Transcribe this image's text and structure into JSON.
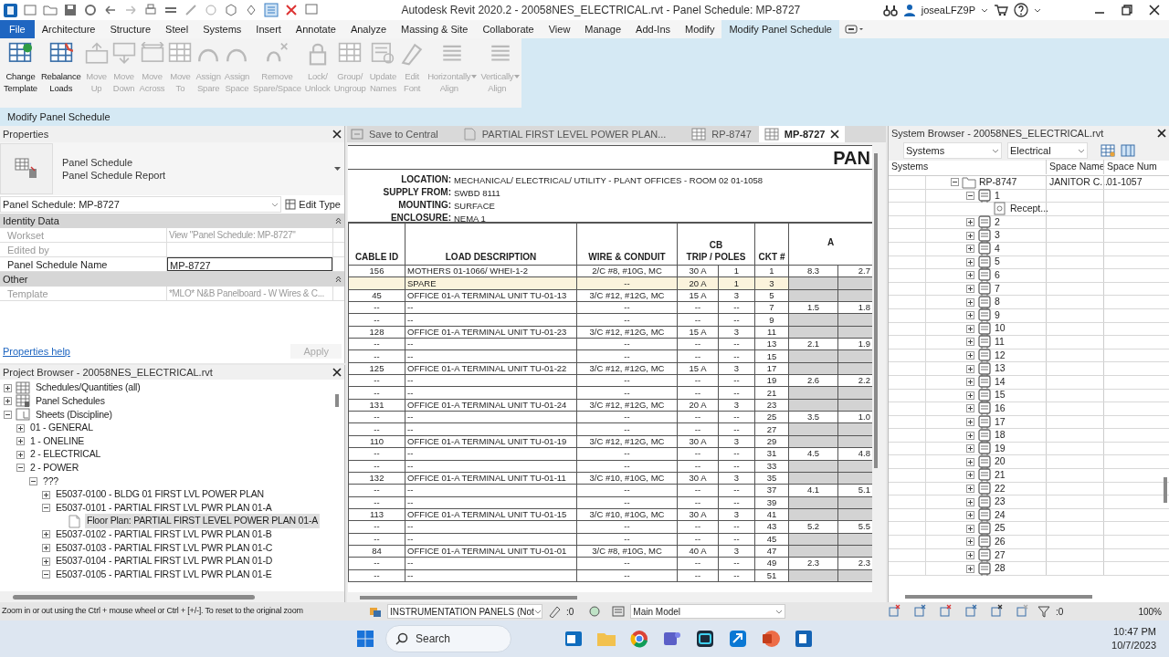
{
  "title_bar": {
    "title": "Autodesk Revit 2020.2 - 20058NES_ELECTRICAL.rvt - Panel Schedule: MP-8727",
    "user": "joseaLFZ9P"
  },
  "ribbon": {
    "file": "File",
    "tabs": [
      {
        "label": "Architecture",
        "selected": false
      },
      {
        "label": "Structure",
        "selected": false
      },
      {
        "label": "Steel",
        "selected": false
      },
      {
        "label": "Systems",
        "selected": false
      },
      {
        "label": "Insert",
        "selected": false
      },
      {
        "label": "Annotate",
        "selected": false
      },
      {
        "label": "Analyze",
        "selected": false
      },
      {
        "label": "Massing & Site",
        "selected": false
      },
      {
        "label": "Collaborate",
        "selected": false
      },
      {
        "label": "View",
        "selected": false
      },
      {
        "label": "Manage",
        "selected": false
      },
      {
        "label": "Add-Ins",
        "selected": false
      },
      {
        "label": "Modify",
        "selected": false
      },
      {
        "label": "Modify Panel Schedule",
        "selected": true
      }
    ],
    "buttons": [
      {
        "label": [
          "Change",
          "Template"
        ],
        "disabled": false
      },
      {
        "label": [
          "Rebalance",
          "Loads"
        ],
        "disabled": false
      },
      {
        "label": [
          "Move",
          "Up"
        ],
        "disabled": true
      },
      {
        "label": [
          "Move",
          "Down"
        ],
        "disabled": true
      },
      {
        "label": [
          "Move",
          "Across"
        ],
        "disabled": true
      },
      {
        "label": [
          "Move",
          "To"
        ],
        "disabled": true
      },
      {
        "label": [
          "Assign",
          "Spare"
        ],
        "disabled": true
      },
      {
        "label": [
          "Assign",
          "Space"
        ],
        "disabled": true
      },
      {
        "label": [
          "Remove",
          "Spare/Space"
        ],
        "disabled": true
      },
      {
        "label": [
          "Lock/",
          "Unlock"
        ],
        "disabled": true
      },
      {
        "label": [
          "Group/",
          "Ungroup"
        ],
        "disabled": true
      },
      {
        "label": [
          "Update",
          "Names"
        ],
        "disabled": true
      },
      {
        "label": [
          "Edit",
          "Font"
        ],
        "disabled": true
      },
      {
        "label": [
          "Horizontally",
          "Align"
        ],
        "disabled": true,
        "dropdown": true
      },
      {
        "label": [
          "Vertically",
          "Align"
        ],
        "disabled": true,
        "dropdown": true
      }
    ],
    "context_bar": "Modify Panel Schedule"
  },
  "properties": {
    "title": "Properties",
    "type_name": "Panel Schedule",
    "type_sub": "Panel Schedule Report",
    "instance": "Panel Schedule: MP-8727",
    "edit_type": "Edit Type",
    "groups": [
      {
        "label": "Identity Data",
        "params": [
          {
            "label": "Workset",
            "value": "View \"Panel Schedule: MP-8727\"",
            "disabled": true
          },
          {
            "label": "Edited by",
            "disabled": true
          },
          {
            "label": "Panel Schedule Name",
            "value": "MP-8727",
            "disabled": false
          }
        ]
      },
      {
        "label": "Other",
        "params": [
          {
            "label": "Template",
            "value": "*MLO* N&B Panelboard - W Wires & C...",
            "disabled": true
          }
        ]
      }
    ],
    "help": "Properties help",
    "apply": {
      "label": "Apply",
      "disabled": true
    }
  },
  "project_browser": {
    "title": "Project Browser - 20058NES_ELECTRICAL.rvt",
    "tree": [
      {
        "label": "Schedules/Quantities (all)",
        "kind": "schedules",
        "expanded": false,
        "selected": false
      },
      {
        "label": "Panel Schedules",
        "kind": "panels",
        "expanded": false,
        "selected": false
      },
      {
        "label": "Sheets (Discipline)",
        "kind": "sheets",
        "expanded": true,
        "selected": false,
        "children": [
          {
            "label": "01 - GENERAL",
            "expanded": false,
            "selected": false
          },
          {
            "label": "1 - ONELINE",
            "expanded": false,
            "selected": false
          },
          {
            "label": "2 - ELECTRICAL",
            "expanded": false,
            "selected": false
          },
          {
            "label": "2 - POWER",
            "expanded": true,
            "selected": false,
            "children": [
              {
                "label": "???",
                "expanded": true,
                "selected": false,
                "children": [
                  {
                    "label": "E5037-0100 - BLDG 01 FIRST LVL POWER PLAN",
                    "expanded": false,
                    "selected": false
                  },
                  {
                    "label": "E5037-0101 - PARTIAL FIRST LVL PWR PLAN 01-A",
                    "expanded": true,
                    "selected": false,
                    "children": [
                      {
                        "label": "Floor Plan: PARTIAL FIRST LEVEL POWER PLAN 01-A",
                        "kind": "view",
                        "selected": true
                      }
                    ]
                  },
                  {
                    "label": "E5037-0102 - PARTIAL FIRST LVL PWR PLAN 01-B",
                    "expanded": false,
                    "selected": false
                  },
                  {
                    "label": "E5037-0103 - PARTIAL FIRST LVL PWR PLAN 01-C",
                    "expanded": false,
                    "selected": false
                  },
                  {
                    "label": "E5037-0104 - PARTIAL FIRST LVL PWR PLAN 01-D",
                    "expanded": false,
                    "selected": false
                  },
                  {
                    "label": "E5037-0105 - PARTIAL FIRST LVL PWR PLAN 01-E",
                    "expanded": true,
                    "selected": false
                  }
                ]
              }
            ]
          }
        ]
      }
    ]
  },
  "view_tabs": {
    "save_to_central": "Save to Central",
    "tabs": [
      {
        "label": "PARTIAL FIRST LEVEL POWER PLAN...",
        "kind": "plan",
        "selected": false
      },
      {
        "label": "RP-8747",
        "kind": "schedule",
        "selected": false
      },
      {
        "label": "MP-8727",
        "kind": "schedule",
        "selected": true
      }
    ]
  },
  "schedule": {
    "title": "PAN",
    "info": [
      {
        "label": "LOCATION:",
        "value": "MECHANICAL/ ELECTRICAL/ UTILITY - PLANT OFFICES - ROOM 02 01-1058"
      },
      {
        "label": "SUPPLY FROM:",
        "value": "SWBD 8111"
      },
      {
        "label": "MOUNTING:",
        "value": "SURFACE"
      },
      {
        "label": "ENCLOSURE:",
        "value": "NEMA 1"
      }
    ],
    "columns": [
      {
        "lines": [
          "CABLE ID"
        ]
      },
      {
        "lines": [
          "LOAD DESCRIPTION"
        ]
      },
      {
        "lines": [
          "WIRE & CONDUIT"
        ]
      },
      {
        "lines": [
          "CB",
          "TRIP / POLES"
        ]
      },
      {
        "lines": [
          "CKT #"
        ]
      },
      {
        "lines": [
          "A"
        ]
      }
    ],
    "rows": [
      {
        "cable": "156",
        "load": "MOTHERS 01-1066/ WHEI-1-2",
        "wire": "2/C #8, #10G, MC",
        "trip": "30 A",
        "poles": "1",
        "ckt": "1",
        "phase_a": [
          "8.3",
          "2.7"
        ],
        "selected": false
      },
      {
        "load": "SPARE",
        "wire": "--",
        "trip": "20 A",
        "poles": "1",
        "ckt": "3",
        "selected": true
      },
      {
        "cable": "45",
        "load": "OFFICE 01-A TERMINAL UNIT TU-01-13",
        "wire": "3/C #12, #12G, MC",
        "trip": "15 A",
        "poles": "3",
        "ckt": "5",
        "selected": false
      },
      {
        "cable": "--",
        "load": "--",
        "wire": "--",
        "trip": "--",
        "poles": "--",
        "ckt": "7",
        "phase_a": [
          "1.5",
          "1.8"
        ],
        "selected": false
      },
      {
        "cable": "--",
        "load": "--",
        "wire": "--",
        "trip": "--",
        "poles": "--",
        "ckt": "9",
        "selected": false
      },
      {
        "cable": "128",
        "load": "OFFICE 01-A TERMINAL UNIT TU-01-23",
        "wire": "3/C #12, #12G, MC",
        "trip": "15 A",
        "poles": "3",
        "ckt": "11",
        "selected": false
      },
      {
        "cable": "--",
        "load": "--",
        "wire": "--",
        "trip": "--",
        "poles": "--",
        "ckt": "13",
        "phase_a": [
          "2.1",
          "1.9"
        ],
        "selected": false
      },
      {
        "cable": "--",
        "load": "--",
        "wire": "--",
        "trip": "--",
        "poles": "--",
        "ckt": "15",
        "selected": false
      },
      {
        "cable": "125",
        "load": "OFFICE 01-A TERMINAL UNIT TU-01-22",
        "wire": "3/C #12, #12G, MC",
        "trip": "15 A",
        "poles": "3",
        "ckt": "17",
        "selected": false
      },
      {
        "cable": "--",
        "load": "--",
        "wire": "--",
        "trip": "--",
        "poles": "--",
        "ckt": "19",
        "phase_a": [
          "2.6",
          "2.2"
        ],
        "selected": false
      },
      {
        "cable": "--",
        "load": "--",
        "wire": "--",
        "trip": "--",
        "poles": "--",
        "ckt": "21",
        "selected": false
      },
      {
        "cable": "131",
        "load": "OFFICE 01-A TERMINAL UNIT TU-01-24",
        "wire": "3/C #12, #12G, MC",
        "trip": "20 A",
        "poles": "3",
        "ckt": "23",
        "selected": false
      },
      {
        "cable": "--",
        "load": "--",
        "wire": "--",
        "trip": "--",
        "poles": "--",
        "ckt": "25",
        "phase_a": [
          "3.5",
          "1.0"
        ],
        "selected": false
      },
      {
        "cable": "--",
        "load": "--",
        "wire": "--",
        "trip": "--",
        "poles": "--",
        "ckt": "27",
        "selected": false
      },
      {
        "cable": "110",
        "load": "OFFICE 01-A TERMINAL UNIT TU-01-19",
        "wire": "3/C #12, #12G, MC",
        "trip": "30 A",
        "poles": "3",
        "ckt": "29",
        "selected": false
      },
      {
        "cable": "--",
        "load": "--",
        "wire": "--",
        "trip": "--",
        "poles": "--",
        "ckt": "31",
        "phase_a": [
          "4.5",
          "4.8"
        ],
        "selected": false
      },
      {
        "cable": "--",
        "load": "--",
        "wire": "--",
        "trip": "--",
        "poles": "--",
        "ckt": "33",
        "selected": false
      },
      {
        "cable": "132",
        "load": "OFFICE 01-A TERMINAL UNIT TU-01-11",
        "wire": "3/C #10, #10G, MC",
        "trip": "30 A",
        "poles": "3",
        "ckt": "35",
        "selected": false
      },
      {
        "cable": "--",
        "load": "--",
        "wire": "--",
        "trip": "--",
        "poles": "--",
        "ckt": "37",
        "phase_a": [
          "4.1",
          "5.1"
        ],
        "selected": false
      },
      {
        "cable": "--",
        "load": "--",
        "wire": "--",
        "trip": "--",
        "poles": "--",
        "ckt": "39",
        "selected": false
      },
      {
        "cable": "113",
        "load": "OFFICE 01-A TERMINAL UNIT TU-01-15",
        "wire": "3/C #10, #10G, MC",
        "trip": "30 A",
        "poles": "3",
        "ckt": "41",
        "selected": false
      },
      {
        "cable": "--",
        "load": "--",
        "wire": "--",
        "trip": "--",
        "poles": "--",
        "ckt": "43",
        "phase_a": [
          "5.2",
          "5.5"
        ],
        "selected": false
      },
      {
        "cable": "--",
        "load": "--",
        "wire": "--",
        "trip": "--",
        "poles": "--",
        "ckt": "45",
        "selected": false
      },
      {
        "cable": "84",
        "load": "OFFICE 01-A TERMINAL UNIT TU-01-01",
        "wire": "3/C #8, #10G, MC",
        "trip": "40 A",
        "poles": "3",
        "ckt": "47",
        "selected": false
      },
      {
        "cable": "--",
        "load": "--",
        "wire": "--",
        "trip": "--",
        "poles": "--",
        "ckt": "49",
        "phase_a": [
          "2.3",
          "2.3"
        ],
        "selected": false
      },
      {
        "cable": "--",
        "load": "--",
        "wire": "--",
        "trip": "--",
        "poles": "--",
        "ckt": "51",
        "selected": false
      }
    ]
  },
  "system_browser": {
    "title": "System Browser - 20058NES_ELECTRICAL.rvt",
    "view": "Systems",
    "discipline": "Electrical",
    "columns": [
      "Systems",
      "Space Name",
      "Space Num"
    ],
    "tree": [
      {
        "label": "RP-8747",
        "kind": "panel",
        "expanded": true,
        "space_name": "JANITOR C...",
        "space_num": "01-1057",
        "children": [
          {
            "label": "1",
            "kind": "circuit",
            "expanded": true,
            "children": [
              {
                "label": "Recept...",
                "kind": "device"
              }
            ]
          },
          {
            "label": "2",
            "kind": "circuit",
            "expanded": false
          },
          {
            "label": "3",
            "kind": "circuit",
            "expanded": false
          },
          {
            "label": "4",
            "kind": "circuit",
            "expanded": false
          },
          {
            "label": "5",
            "kind": "circuit",
            "expanded": false
          },
          {
            "label": "6",
            "kind": "circuit",
            "expanded": false
          },
          {
            "label": "7",
            "kind": "circuit",
            "expanded": false
          },
          {
            "label": "8",
            "kind": "circuit",
            "expanded": false
          },
          {
            "label": "9",
            "kind": "circuit",
            "expanded": false
          },
          {
            "label": "10",
            "kind": "circuit",
            "expanded": false
          },
          {
            "label": "11",
            "kind": "circuit",
            "expanded": false
          },
          {
            "label": "12",
            "kind": "circuit",
            "expanded": false
          },
          {
            "label": "13",
            "kind": "circuit",
            "expanded": false
          },
          {
            "label": "14",
            "kind": "circuit",
            "expanded": false
          },
          {
            "label": "15",
            "kind": "circuit",
            "expanded": false
          },
          {
            "label": "16",
            "kind": "circuit",
            "expanded": false
          },
          {
            "label": "17",
            "kind": "circuit",
            "expanded": false
          },
          {
            "label": "18",
            "kind": "circuit",
            "expanded": false
          },
          {
            "label": "19",
            "kind": "circuit",
            "expanded": false
          },
          {
            "label": "20",
            "kind": "circuit",
            "expanded": false
          },
          {
            "label": "21",
            "kind": "circuit",
            "expanded": false
          },
          {
            "label": "22",
            "kind": "circuit",
            "expanded": false
          },
          {
            "label": "23",
            "kind": "circuit",
            "expanded": false
          },
          {
            "label": "24",
            "kind": "circuit",
            "expanded": false
          },
          {
            "label": "25",
            "kind": "circuit",
            "expanded": false
          },
          {
            "label": "26",
            "kind": "circuit",
            "expanded": false
          },
          {
            "label": "27",
            "kind": "circuit",
            "expanded": false
          },
          {
            "label": "28",
            "kind": "circuit",
            "expanded": false
          }
        ]
      }
    ]
  },
  "status_bar": {
    "hint": "Zoom in or out using the Ctrl + mouse wheel or Ctrl + [+/-]. To reset to the original zoom",
    "workset": "INSTRUMENTATION PANELS (Not",
    "editable_count": ":0",
    "design_option": "Main Model",
    "filter_count": ":0",
    "zoom": "100%"
  },
  "taskbar": {
    "search": "Search",
    "time": "10:47 PM",
    "date": "10/7/2023"
  }
}
